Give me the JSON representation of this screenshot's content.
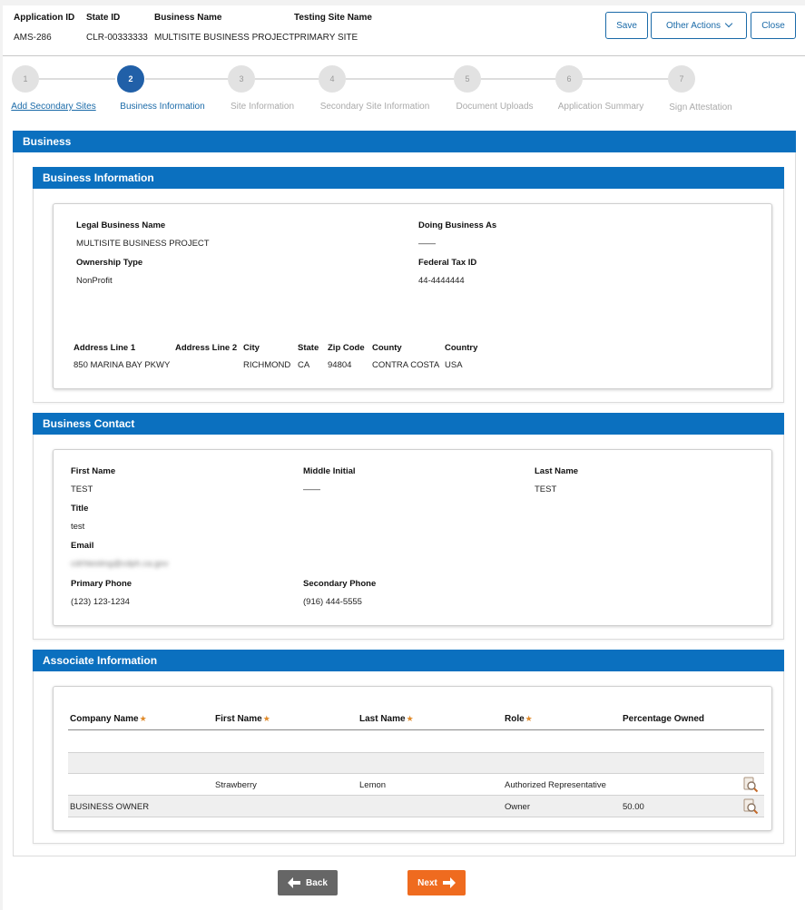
{
  "header": {
    "application_id_label": "Application ID",
    "application_id": "AMS-286",
    "state_id_label": "State ID",
    "state_id": "CLR-00333333",
    "business_name_label": "Business Name",
    "business_name": "MULTISITE BUSINESS PROJECT",
    "testing_site_label": "Testing Site Name",
    "testing_site": "PRIMARY SITE",
    "save": "Save",
    "other_actions": "Other Actions",
    "close": "Close"
  },
  "steps": [
    {
      "number": "1",
      "label": "Add Secondary Sites",
      "state": "link"
    },
    {
      "number": "2",
      "label": "Business Information",
      "state": "current"
    },
    {
      "number": "3",
      "label": "Site Information",
      "state": "inactive"
    },
    {
      "number": "4",
      "label": "Secondary Site Information",
      "state": "inactive"
    },
    {
      "number": "5",
      "label": "Document Uploads",
      "state": "inactive"
    },
    {
      "number": "6",
      "label": "Application Summary",
      "state": "inactive"
    },
    {
      "number": "7",
      "label": "Sign Attestation",
      "state": "inactive"
    }
  ],
  "section_title": "Business",
  "business_info": {
    "title": "Business Information",
    "legal_name_label": "Legal Business Name",
    "legal_name": "MULTISITE BUSINESS PROJECT",
    "dba_label": "Doing Business As",
    "dba": "——",
    "ownership_label": "Ownership Type",
    "ownership": "NonProfit",
    "tax_id_label": "Federal Tax ID",
    "tax_id": "44-4444444",
    "address": {
      "line1_label": "Address Line 1",
      "line1": "850 MARINA BAY PKWY",
      "line2_label": "Address Line 2",
      "line2": "",
      "city_label": "City",
      "city": "RICHMOND",
      "state_label": "State",
      "state": "CA",
      "zip_label": "Zip Code",
      "zip": "94804",
      "county_label": "County",
      "county": "CONTRA COSTA",
      "country_label": "Country",
      "country": "USA"
    }
  },
  "business_contact": {
    "title": "Business Contact",
    "first_name_label": "First Name",
    "first_name": "TEST",
    "middle_initial_label": "Middle Initial",
    "middle_initial": "——",
    "last_name_label": "Last Name",
    "last_name": "TEST",
    "title_label": "Title",
    "title_value": "test",
    "email_label": "Email",
    "email": "cdrhtesting@cdph.ca.gov",
    "primary_phone_label": "Primary Phone",
    "primary_phone": "(123) 123-1234",
    "secondary_phone_label": "Secondary Phone",
    "secondary_phone": "(916) 444-5555"
  },
  "associates": {
    "title": "Associate Information",
    "columns": [
      "Company Name",
      "First Name",
      "Last Name",
      "Role",
      "Percentage Owned"
    ],
    "required_marker": "★",
    "rows": [
      {
        "company": "",
        "first": "",
        "last": "",
        "role": "",
        "pct": ""
      },
      {
        "company": "",
        "first": "Strawberry",
        "last": "Lemon",
        "role": "Authorized Representative",
        "pct": ""
      },
      {
        "company": "BUSINESS OWNER",
        "first": "",
        "last": "",
        "role": "Owner",
        "pct": "50.00"
      }
    ]
  },
  "nav": {
    "back": "Back",
    "next": "Next"
  },
  "colors": {
    "primary_bar": "#0b70bf",
    "step_active": "#2160a8",
    "next_button": "#ef6b1f",
    "back_button": "#666666",
    "required_star": "#e08a2a"
  }
}
